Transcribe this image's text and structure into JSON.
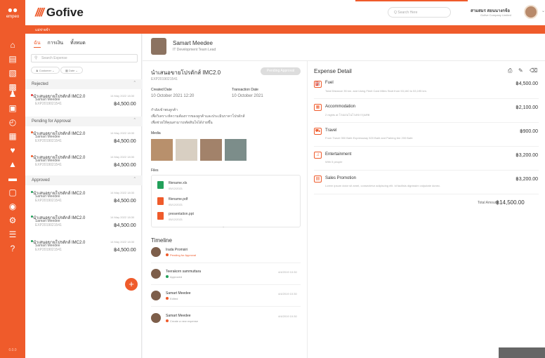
{
  "rail": {
    "logo": "empeo",
    "version": "0.0.0",
    "icons": [
      "home-icon",
      "document-icon",
      "receipt-icon",
      "wallet-icon",
      "people-icon",
      "reports-icon",
      "time-icon",
      "calendar-icon",
      "health-icon",
      "education-icon",
      "briefcase-icon",
      "finance-icon",
      "benefit-icon",
      "settings-icon",
      "documents-icon",
      "help-icon"
    ]
  },
  "topbar": {
    "brand": "Gofive",
    "search_placeholder": "Q  Search Here",
    "user_name": "สามสมร สอนนางกจ้อ",
    "user_company": "Gofive Company Limited"
  },
  "breadcrumb": "แม่ข่ายจ้า",
  "list": {
    "tabs": [
      "ฉัน",
      "การเงิน",
      "ทั้งหมด"
    ],
    "search_placeholder": "Search Expense",
    "chips": [
      "Customer",
      "Date"
    ],
    "sections": [
      {
        "title": "Rejected",
        "items": [
          {
            "title": "นำเสนอขายโปรดักส์ IMC2.0",
            "name": "Samart Meedee",
            "code": "EXP2019021541",
            "date": "14 May 2022 18:30",
            "amount": "฿4,500.00",
            "dot": "#e23a3a"
          }
        ]
      },
      {
        "title": "Pending for Approval",
        "items": [
          {
            "title": "นำเสนอขายโปรดักส์ IMC2.0",
            "name": "Samart Meedee",
            "code": "EXP2019021541",
            "date": "14 May 2022 18:30",
            "amount": "฿4,500.00",
            "dot": "#ef5b2b"
          },
          {
            "title": "นำเสนอขายโปรดักส์ IMC2.0",
            "name": "Samart Meedee",
            "code": "EXP2019021541",
            "date": "14 May 2022 18:30",
            "amount": "฿4,500.00",
            "dot": "#ef5b2b"
          }
        ]
      },
      {
        "title": "Approved",
        "items": [
          {
            "title": "นำเสนอขายโปรดักส์ IMC2.0",
            "name": "Samart Meedee",
            "code": "EXP2019021541",
            "date": "14 May 2022 18:30",
            "amount": "฿4,500.00",
            "dot": "#22a05a"
          },
          {
            "title": "นำเสนอขายโปรดักส์ IMC2.0",
            "name": "Samart Meedee",
            "code": "EXP2019021541",
            "date": "14 May 2022 18:30",
            "amount": "฿4,500.00",
            "dot": "#22a05a"
          },
          {
            "title": "นำเสนอขายโปรดักส์ IMC2.0",
            "name": "Samart Meedee",
            "code": "EXP2019021541",
            "date": "14 May 2022 18:30",
            "amount": "฿4,500.00",
            "dot": "#22a05a"
          }
        ]
      }
    ]
  },
  "header": {
    "name": "Samart Meedee",
    "role": "IT Development Team Lead"
  },
  "detail": {
    "title": "นำเสนอขายโปรดักส์ IMC2.0",
    "code": "EXP2019021541",
    "status": "Pending Approval",
    "created_label": "Created Date",
    "created": "10 October 2021 12:20",
    "transaction_label": "Transaction Date",
    "transaction": "10 October 2021",
    "desc1": "กำลังเข้าพบลูกค้า",
    "desc2": "เพื่อวิเคราะห์ความต้องการของลูกค้าและประเมินราคาโปรดักส์",
    "desc3": "เพื่อช่วยให้คุณสามารถตัดสินใจได้ง่ายขึ้น",
    "media_label": "Media",
    "files_label": "Files",
    "files": [
      {
        "name": "filename.xls",
        "date": "05/12/2021",
        "icon": "excel-file-icon"
      },
      {
        "name": "filename.pdf",
        "date": "05/12/2021",
        "icon": "pdf-file-icon"
      },
      {
        "name": "presentation.ppt",
        "date": "05/12/2021",
        "icon": "ppt-file-icon"
      }
    ]
  },
  "timeline": {
    "title": "Timeline",
    "entries": [
      {
        "name": "Irada Promsiri",
        "status": "Pending for Approval",
        "date": ""
      },
      {
        "name": "Teerakorn sammuttara",
        "status": "Approved",
        "date": "4/4/2019 10:30"
      },
      {
        "name": "Samart Meedee",
        "status": "Edited",
        "date": "4/4/2019 10:30"
      },
      {
        "name": "Samart Meedee",
        "status": "Create a new expense",
        "date": "4/4/2019 10:30"
      }
    ]
  },
  "expense": {
    "title": "Expense Detail",
    "items": [
      {
        "name": "Fuel",
        "desc": "Total Distance 35 km. and Using Fleet Card Miles Start from 53,160 to 53,195 km.",
        "amount": "฿4,500.00",
        "icon": "fuel-icon"
      },
      {
        "name": "Accommodation",
        "desc": "2 nights at โรงแรมโนโวเทล กรุงเทพ",
        "amount": "฿2,100.00",
        "icon": "hotel-icon"
      },
      {
        "name": "Travel",
        "desc": "From Travel 350 Baht Expressway 520 Baht and Parking fee 200 Baht",
        "amount": "฿900.00",
        "icon": "travel-icon"
      },
      {
        "name": "Entertainment",
        "desc": "With 5 people",
        "amount": "฿3,200.00",
        "icon": "entertainment-icon"
      },
      {
        "name": "Sales Promotion",
        "desc": "Lorem ipsum dolor sit amet, consectetur adipiscing elit. Id facilisis dignissim vulputate donec.",
        "amount": "฿3,200.00",
        "icon": "promotion-icon"
      }
    ],
    "total_label": "Total Amount",
    "total": "฿14,500.00"
  }
}
